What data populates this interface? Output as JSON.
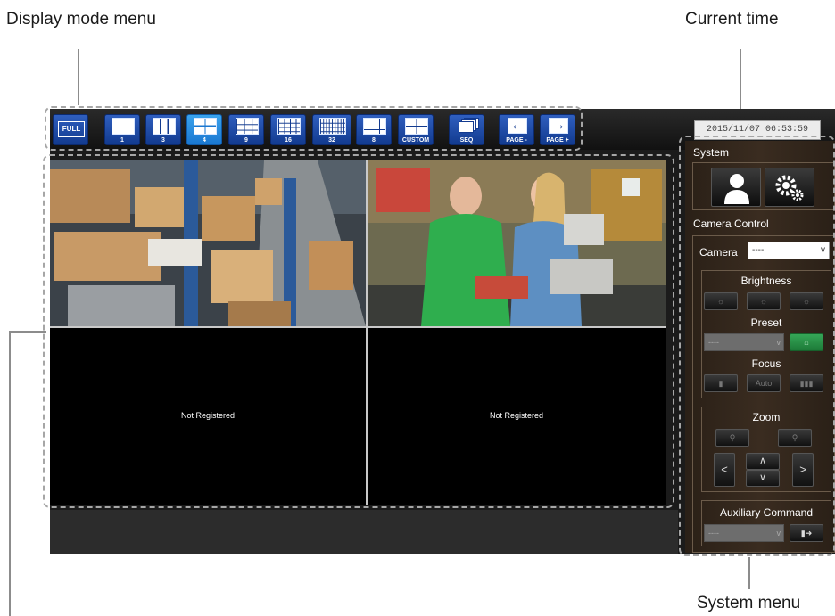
{
  "callouts": {
    "display_mode_menu": "Display mode menu",
    "current_time": "Current time",
    "system_menu": "System menu"
  },
  "toolbar": {
    "buttons": [
      {
        "id": "full",
        "label": "FULL"
      },
      {
        "id": "single",
        "label": "1"
      },
      {
        "id": "split3",
        "label": "3"
      },
      {
        "id": "split4",
        "label": "4",
        "active": true
      },
      {
        "id": "split9",
        "label": "9"
      },
      {
        "id": "split16",
        "label": "16"
      },
      {
        "id": "split32",
        "label": "32"
      },
      {
        "id": "split8",
        "label": "8"
      },
      {
        "id": "custom",
        "label": "CUSTOM"
      },
      {
        "id": "seq",
        "label": "SEQ"
      },
      {
        "id": "page_prev",
        "label": "PAGE -",
        "icon": "arrow-left-icon"
      },
      {
        "id": "page_next",
        "label": "PAGE +",
        "icon": "arrow-right-icon"
      }
    ],
    "active_color": "#1a77d0",
    "button_color": "#123a8f"
  },
  "clock": "2015/11/07 06:53:59",
  "cells": [
    {
      "content": "warehouse camera feed"
    },
    {
      "content": "checkout camera feed"
    },
    {
      "text": "Not Registered"
    },
    {
      "text": "Not Registered"
    }
  ],
  "side": {
    "system_title": "System",
    "system_icons": [
      "user-icon",
      "gears-icon"
    ],
    "camera_control_title": "Camera Control",
    "camera_label": "Camera",
    "camera_value": "----",
    "brightness_label": "Brightness",
    "preset_label": "Preset",
    "preset_value": "----",
    "focus_label": "Focus",
    "focus_auto": "Auto",
    "zoom_label": "Zoom",
    "aux_label": "Auxiliary Command",
    "aux_value": "----",
    "nav": {
      "left": "<",
      "right": ">",
      "up": "∧",
      "down": "∨"
    }
  }
}
